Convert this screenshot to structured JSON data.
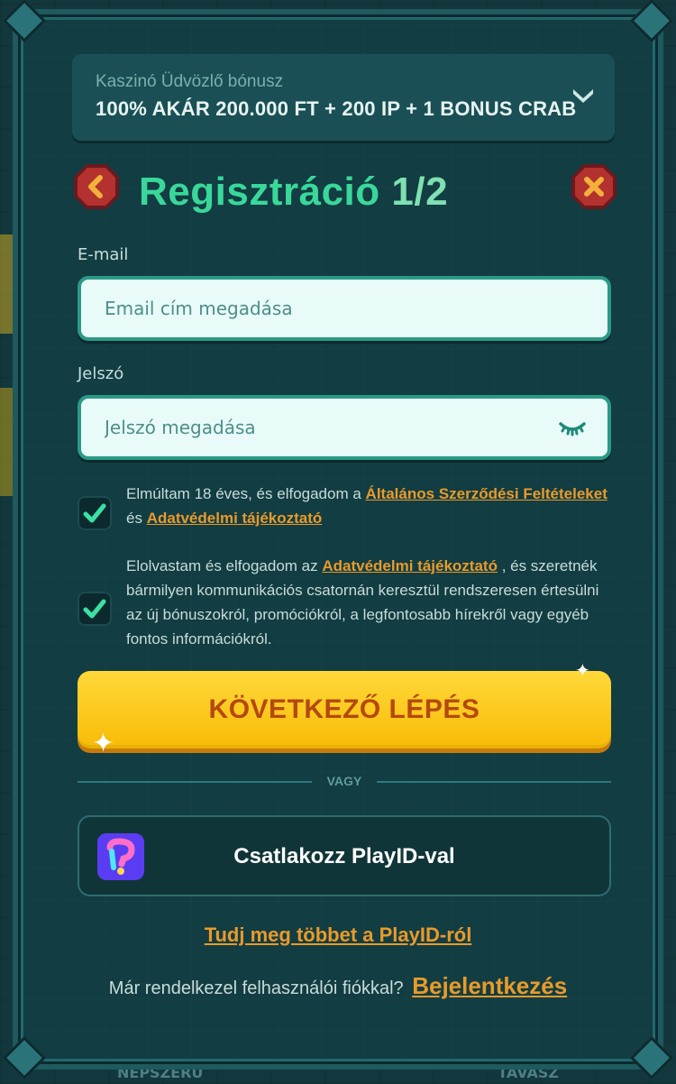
{
  "bonus": {
    "title": "Kaszinó Üdvözlő bónusz",
    "text": "100% AKÁR 200.000 FT + 200 IP + 1 BONUS CRAB"
  },
  "registration": {
    "title": "Regisztráció",
    "step": "1/2"
  },
  "email": {
    "label": "E-mail",
    "placeholder": "Email cím megadása",
    "value": ""
  },
  "password": {
    "label": "Jelszó",
    "placeholder": "Jelszó megadása",
    "value": ""
  },
  "terms": {
    "checked": true,
    "text_before": "Elmúltam 18 éves, és elfogadom a",
    "link1": "Általános Szerződési Feltételeket",
    "text_middle": "és",
    "link2": "Adatvédelmi tájékoztató"
  },
  "marketing": {
    "checked": true,
    "text_before": "Elolvastam és elfogadom az",
    "link": "Adatvédelmi tájékoztató",
    "text_after": ", és szeretnék bármilyen kommunikációs csatornán keresztül rendszeresen értesülni az új bónuszokról, promóciókról, a legfontosabb hírekről vagy egyéb fontos információkról."
  },
  "next_button": "KÖVETKEZŐ LÉPÉS",
  "divider_text": "VAGY",
  "playid": {
    "button_label": "Csatlakozz PlayID-val",
    "learn_more": "Tudj meg többet a PlayID-ról"
  },
  "login": {
    "question": "Már rendelkezel felhasználói fiókkal?",
    "link": "Bejelentkezés"
  },
  "background": {
    "bottom_left": "NEPSZERŰ",
    "bottom_right": "TAVASZ"
  },
  "colors": {
    "accent_green": "#39d89a",
    "link_orange": "#e99a2a",
    "button_yellow": "#ffd93a",
    "button_text": "#b5480f",
    "panel": "#123d42"
  },
  "icons": [
    "back-arrow-icon",
    "close-icon",
    "chevron-down-icon",
    "eye-closed-icon",
    "checkmark-icon",
    "playid-logo-icon",
    "sparkle-icon"
  ]
}
